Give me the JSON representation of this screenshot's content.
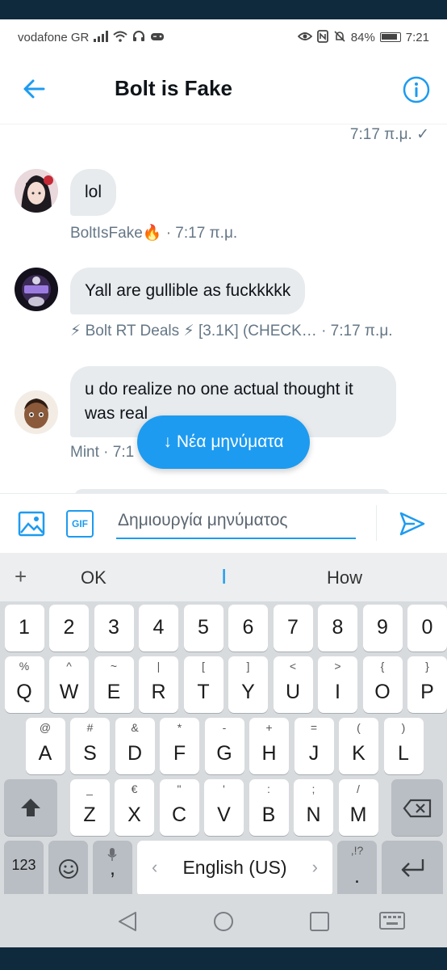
{
  "status_bar": {
    "carrier": "vodafone GR",
    "battery": "84%",
    "time": "7:21"
  },
  "header": {
    "title": "Bolt is Fake"
  },
  "chat": {
    "previous_time": "7:17 π.μ. ✓",
    "messages": [
      {
        "text": "lol",
        "meta": "BoltIsFake🔥 · 7:17 π.μ."
      },
      {
        "text": "Yall are gullible as fuckkkkk",
        "meta": "⚡ Bolt RT Deals ⚡ [3.1K] (CHECK… · 7:17 π.μ."
      },
      {
        "text_line1": "u do realize no one actual thought it",
        "text_line2": "was real",
        "meta": "Mint · 7:1"
      }
    ],
    "new_messages_label": "↓ Νέα μηνύματα"
  },
  "composer": {
    "gif_label": "GIF",
    "placeholder": "Δημιουργία μηνύματος"
  },
  "keyboard": {
    "suggestions": [
      "+",
      "OK",
      "I",
      "How"
    ],
    "row1": [
      "1",
      "2",
      "3",
      "4",
      "5",
      "6",
      "7",
      "8",
      "9",
      "0"
    ],
    "row2": [
      {
        "main": "Q",
        "sub": "%"
      },
      {
        "main": "W",
        "sub": "^"
      },
      {
        "main": "E",
        "sub": "~"
      },
      {
        "main": "R",
        "sub": "|"
      },
      {
        "main": "T",
        "sub": "["
      },
      {
        "main": "Y",
        "sub": "]"
      },
      {
        "main": "U",
        "sub": "<"
      },
      {
        "main": "I",
        "sub": ">"
      },
      {
        "main": "O",
        "sub": "{"
      },
      {
        "main": "P",
        "sub": "}"
      }
    ],
    "row3": [
      {
        "main": "A",
        "sub": "@"
      },
      {
        "main": "S",
        "sub": "#"
      },
      {
        "main": "D",
        "sub": "&"
      },
      {
        "main": "F",
        "sub": "*"
      },
      {
        "main": "G",
        "sub": "-"
      },
      {
        "main": "H",
        "sub": "+"
      },
      {
        "main": "J",
        "sub": "="
      },
      {
        "main": "K",
        "sub": "("
      },
      {
        "main": "L",
        "sub": ")"
      }
    ],
    "row4": [
      {
        "main": "Z",
        "sub": "_"
      },
      {
        "main": "X",
        "sub": "€"
      },
      {
        "main": "C",
        "sub": "\""
      },
      {
        "main": "V",
        "sub": "'"
      },
      {
        "main": "B",
        "sub": ":"
      },
      {
        "main": "N",
        "sub": ";"
      },
      {
        "main": "M",
        "sub": "/"
      }
    ],
    "num_key": "123",
    "comma_key": ",",
    "space_label": "English (US)",
    "space_left": "‹",
    "space_right": "›",
    "period_key": ".",
    "period_sub": ",!?"
  },
  "colors": {
    "accent": "#1d9bf0",
    "bubble": "#e7ebee",
    "meta_text": "#657786"
  }
}
